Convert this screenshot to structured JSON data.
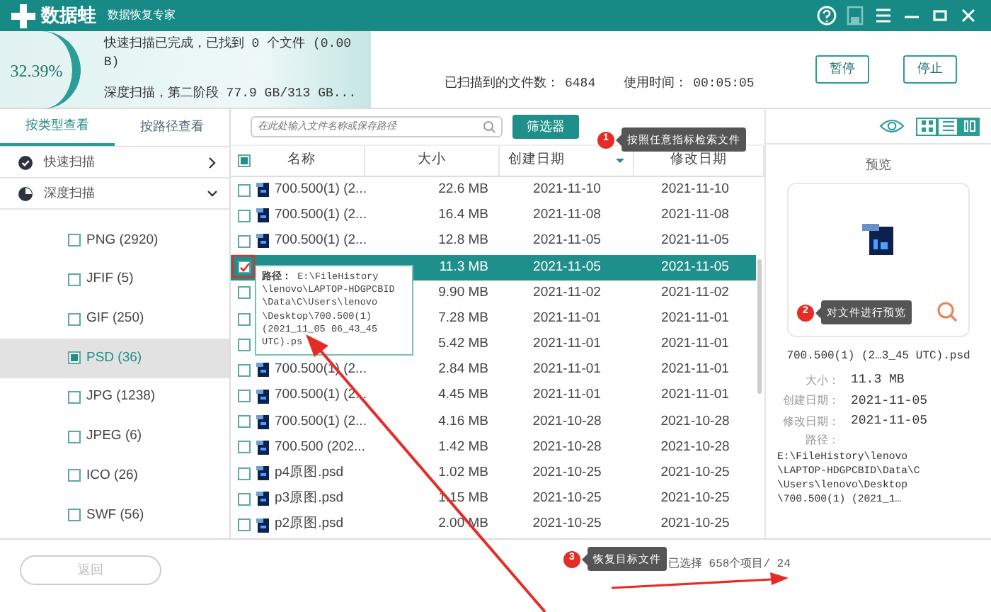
{
  "app": {
    "name": "数据蛙",
    "subtitle": "数据恢复专家"
  },
  "scan_status": {
    "percent": "32.39%",
    "lines": [
      "快速扫描已完成，已找到 0 个文件 (0.00  B)",
      "深度扫描，第二阶段 77.9 GB/313 GB..."
    ],
    "files_label": "已扫描到的文件数：",
    "files_value": "6484",
    "time_label": "使用时间：",
    "time_value": "00:05:05",
    "buttons": [
      "暂停",
      "停止"
    ]
  },
  "sidebar": {
    "tabs": [
      {
        "label": "按类型查看",
        "selected": true
      },
      {
        "label": "按路径查看",
        "selected": false
      }
    ],
    "sections": [
      {
        "kind": "quick",
        "label": "快速扫描",
        "expanded": false
      },
      {
        "kind": "deep",
        "label": "深度扫描",
        "expanded": true,
        "children": [
          {
            "label": "PNG (2920)",
            "checked": false,
            "selected": false
          },
          {
            "label": "JFIF (5)",
            "checked": false,
            "selected": false
          },
          {
            "label": "GIF (250)",
            "checked": false,
            "selected": false
          },
          {
            "label": "PSD (36)",
            "checked": true,
            "selected": true
          },
          {
            "label": "JPG (1238)",
            "checked": false,
            "selected": false
          },
          {
            "label": "JPEG (6)",
            "checked": false,
            "selected": false
          },
          {
            "label": "ICO (26)",
            "checked": false,
            "selected": false
          },
          {
            "label": "SWF (56)",
            "checked": false,
            "selected": false
          }
        ]
      }
    ],
    "back_button": {
      "label": "返回",
      "disabled": true
    }
  },
  "file_list": {
    "search": {
      "placeholder": "在此处输入文件名称或保存路径"
    },
    "filter_button": "筛选器",
    "select_all_checked": true,
    "columns": [
      {
        "label": "名称",
        "sorted": false
      },
      {
        "label": "大小",
        "sorted": false
      },
      {
        "label": "创建日期",
        "sorted": true
      },
      {
        "label": "修改日期",
        "sorted": false
      }
    ],
    "rows": [
      {
        "name": "700.500(1) (2...",
        "size": "22.6 MB",
        "created": "2021-11-10",
        "modified": "2021-11-10",
        "checked": false,
        "selected": false
      },
      {
        "name": "700.500(1) (2...",
        "size": "16.4 MB",
        "created": "2021-11-08",
        "modified": "2021-11-08",
        "checked": false,
        "selected": false
      },
      {
        "name": "700.500(1) (2...",
        "size": "12.8 MB",
        "created": "2021-11-05",
        "modified": "2021-11-05",
        "checked": false,
        "selected": false
      },
      {
        "size": "11.3 MB",
        "created": "2021-11-05",
        "modified": "2021-11-05",
        "checked": true,
        "selected": true
      },
      {
        "size": "9.90 MB",
        "created": "2021-11-02",
        "modified": "2021-11-02",
        "checked": false,
        "selected": false
      },
      {
        "size": "7.28 MB",
        "created": "2021-11-01",
        "modified": "2021-11-01",
        "checked": false,
        "selected": false
      },
      {
        "size": "5.42 MB",
        "created": "2021-11-01",
        "modified": "2021-11-01",
        "checked": false,
        "selected": false
      },
      {
        "name": "700.500(1) (2...",
        "size": "2.84 MB",
        "created": "2021-11-01",
        "modified": "2021-11-01",
        "checked": false,
        "selected": false
      },
      {
        "name": "700.500(1) (2...",
        "size": "4.45 MB",
        "created": "2021-11-01",
        "modified": "2021-11-01",
        "checked": false,
        "selected": false
      },
      {
        "name": "700.500(1) (2...",
        "size": "4.16 MB",
        "created": "2021-10-28",
        "modified": "2021-10-28",
        "checked": false,
        "selected": false
      },
      {
        "name": "700.500 (202...",
        "size": "1.42 MB",
        "created": "2021-10-28",
        "modified": "2021-10-28",
        "checked": false,
        "selected": false
      },
      {
        "name": "p4原图.psd",
        "size": "1.02 MB",
        "created": "2021-10-25",
        "modified": "2021-10-25",
        "checked": false,
        "selected": false
      },
      {
        "name": "p3原图.psd",
        "size": "1.15 MB",
        "created": "2021-10-25",
        "modified": "2021-10-25",
        "checked": false,
        "selected": false
      },
      {
        "name": "p2原图.psd",
        "size": "2.00 MB",
        "created": "2021-10-25",
        "modified": "2021-10-25",
        "checked": false,
        "selected": false
      }
    ],
    "path_tooltip": {
      "label": "路径：",
      "lines": [
        "E:\\FileHistory",
        "\\lenovo\\LAPTOP-HDGPCBID",
        "\\Data\\C\\Users\\lenovo",
        "\\Desktop\\700.500(1)",
        "(2021_11_05 06_43_45",
        "UTC).ps"
      ]
    }
  },
  "callouts": [
    {
      "number": "1",
      "text": "按照任意指标检索文件"
    },
    {
      "number": "2",
      "text": "对文件进行预览"
    },
    {
      "number": "3",
      "text": "恢复目标文件"
    }
  ],
  "preview": {
    "views": [
      {
        "kind": "grid",
        "selected": false
      },
      {
        "kind": "list",
        "selected": false
      },
      {
        "kind": "detail",
        "selected": true
      }
    ],
    "title": "预览",
    "file_name": "700.500(1) (2…3_45 UTC).psd",
    "details": [
      {
        "label": "大小：",
        "value": "11.3 MB"
      },
      {
        "label": "创建日期：",
        "value": "2021-11-05"
      },
      {
        "label": "修改日期：",
        "value": "2021-11-05"
      }
    ],
    "path_label": "路径：",
    "path_lines": [
      "E:\\FileHistory\\lenovo",
      "\\LAPTOP-HDGPCBID\\Data\\C",
      "\\Users\\lenovo\\Desktop",
      "\\700.500(1) (2021_1…"
    ]
  },
  "status_bar": {
    "selection": "已选择 658个项目/ 24"
  }
}
